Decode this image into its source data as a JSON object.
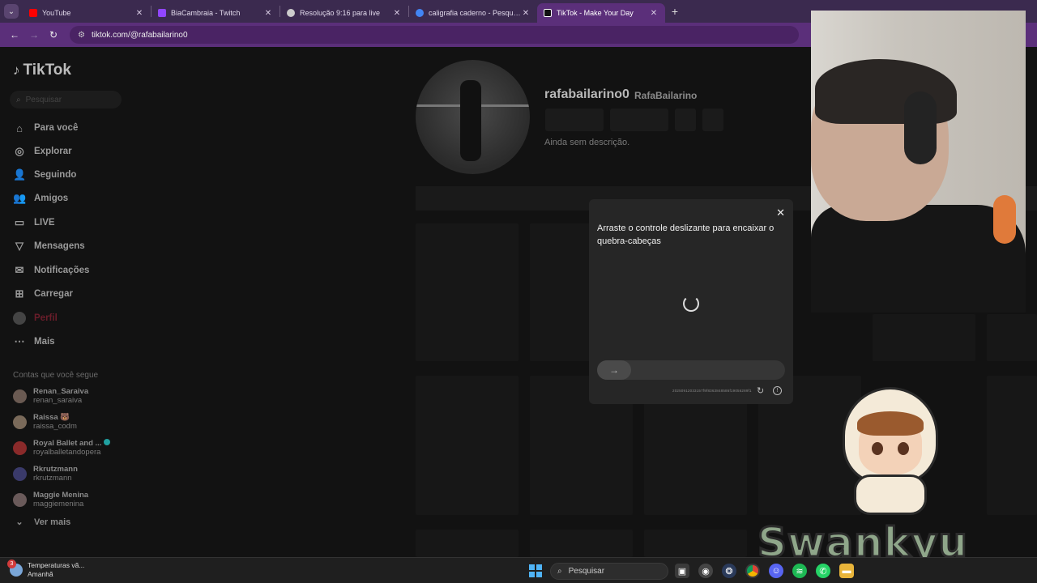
{
  "browser": {
    "tabs": [
      {
        "title": "YouTube",
        "icon": "youtube-icon",
        "color": "#ff0000",
        "active": false
      },
      {
        "title": "BiaCambraia - Twitch",
        "icon": "twitch-icon",
        "color": "#9146ff",
        "active": false
      },
      {
        "title": "Resolução 9:16 para live",
        "icon": "chatgpt-icon",
        "color": "#cccccc",
        "active": false
      },
      {
        "title": "caligrafia caderno - Pesquisa Google",
        "icon": "google-icon",
        "color": "#4285f4",
        "active": false
      },
      {
        "title": "TikTok - Make Your Day",
        "icon": "tiktok-icon",
        "color": "#ffffff",
        "active": true
      }
    ],
    "url": "tiktok.com/@rafabailarino0"
  },
  "tiktok": {
    "logo": "TikTok",
    "search_placeholder": "Pesquisar",
    "menu": [
      {
        "label": "Para você",
        "icon": "home-icon"
      },
      {
        "label": "Explorar",
        "icon": "compass-icon"
      },
      {
        "label": "Seguindo",
        "icon": "following-icon"
      },
      {
        "label": "Amigos",
        "icon": "friends-icon"
      },
      {
        "label": "LIVE",
        "icon": "live-icon"
      },
      {
        "label": "Mensagens",
        "icon": "messages-icon"
      },
      {
        "label": "Notificações",
        "icon": "notifications-icon"
      },
      {
        "label": "Carregar",
        "icon": "upload-icon"
      },
      {
        "label": "Perfil",
        "icon": "profile-icon"
      },
      {
        "label": "Mais",
        "icon": "more-icon"
      }
    ],
    "following_title": "Contas que você segue",
    "following": [
      {
        "name": "Renan_Saraiva",
        "handle": "renan_saraiva",
        "color": "#6a5a52"
      },
      {
        "name": "Raissa 🐻",
        "handle": "raissa_codm",
        "color": "#7a6a5a"
      },
      {
        "name": "Royal Ballet and ...",
        "handle": "royalballetandopera",
        "color": "#8a2a2a"
      },
      {
        "name": "Rkrutzmann",
        "handle": "rkrutzmann",
        "color": "#3a3a6a"
      },
      {
        "name": "Maggie Menina",
        "handle": "maggiemenina",
        "color": "#6a5a5a"
      }
    ],
    "see_more": "Ver mais",
    "profile": {
      "username": "rafabailarino0",
      "nickname": "RafaBailarino",
      "bio": "Ainda sem descrição."
    }
  },
  "captcha": {
    "title": "Arraste o controle deslizante para encaixar o quebra-cabeças",
    "code": "20250912033157f9f8363848586f19056289f1"
  },
  "overlay": {
    "brand": "Swankyu"
  },
  "taskbar": {
    "weather_title": "Temperaturas vã...",
    "weather_sub": "Amanhã",
    "weather_badge": "3",
    "search": "Pesquisar"
  }
}
